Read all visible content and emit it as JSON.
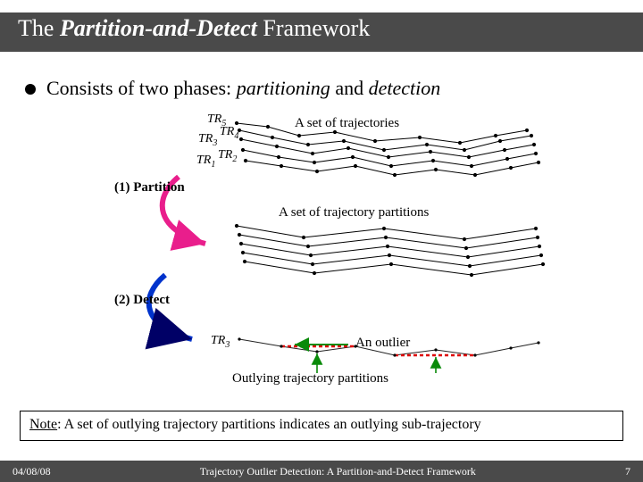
{
  "title": {
    "pre": "The ",
    "bold": "Partition-and-Detect",
    "post": " Framework"
  },
  "bullet": {
    "pre": "Consists of two phases: ",
    "p1": "partitioning",
    "mid": " and ",
    "p2": "detection"
  },
  "labels": {
    "tr5": "TR",
    "tr5s": "5",
    "tr4": "TR",
    "tr4s": "4",
    "tr3a": "TR",
    "tr3as": "3",
    "tr2": "TR",
    "tr2s": "2",
    "tr1": "TR",
    "tr1s": "1",
    "tr3b": "TR",
    "tr3bs": "3"
  },
  "ann": {
    "set_trajs": "A set of trajectories",
    "set_parts": "A set of trajectory partitions",
    "outlier": "An outlier",
    "outlying_parts": "Outlying trajectory partitions"
  },
  "steps": {
    "s1": "(1) Partition",
    "s2": "(2) Detect"
  },
  "note": {
    "head": "Note",
    "body": ": A set of outlying trajectory partitions indicates an outlying sub-trajectory"
  },
  "footer": {
    "date": "04/08/08",
    "center": "Trajectory Outlier Detection: A Partition-and-Detect Framework",
    "page": "7"
  }
}
